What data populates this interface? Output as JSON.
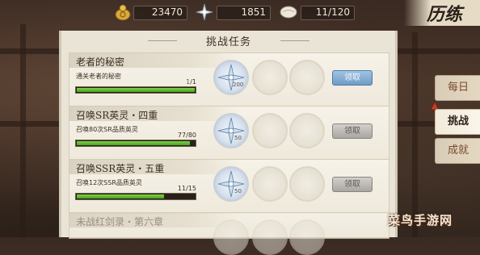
{
  "currencies": [
    {
      "icon": "coin-bag-icon",
      "value": "23470"
    },
    {
      "icon": "star-shard-icon",
      "value": "1851"
    },
    {
      "icon": "paper-scroll-icon",
      "value": "11/120"
    }
  ],
  "screen_title": "历练",
  "panel": {
    "title": "挑战任务"
  },
  "tasks": [
    {
      "name": "老者的秘密",
      "desc": "通关老者的秘密",
      "progress": "1",
      "target": "1",
      "reward_count": "200",
      "button": "领取",
      "button_enabled": true
    },
    {
      "name": "召唤SR英灵・四重",
      "desc": "召唤80次SR品质英灵",
      "progress": "77",
      "target": "80",
      "reward_count": "50",
      "button": "领取",
      "button_enabled": false
    },
    {
      "name": "召唤SSR英灵・五重",
      "desc": "召唤12次SSR品质英灵",
      "progress": "11",
      "target": "15",
      "reward_count": "50",
      "button": "领取",
      "button_enabled": false
    },
    {
      "name": "未战红剑录・第六章",
      "desc": "",
      "progress": "",
      "target": "",
      "reward_count": "",
      "button": "",
      "button_enabled": false
    }
  ],
  "side_tabs": [
    {
      "label": "每日",
      "active": false
    },
    {
      "label": "挑战",
      "active": true
    },
    {
      "label": "成就",
      "active": false
    }
  ],
  "watermark": "菜鸟手游网",
  "colors": {
    "progress_green": "#45a31a",
    "claim_blue": "#6f9cc6",
    "panel_paper": "#eae4d6"
  }
}
